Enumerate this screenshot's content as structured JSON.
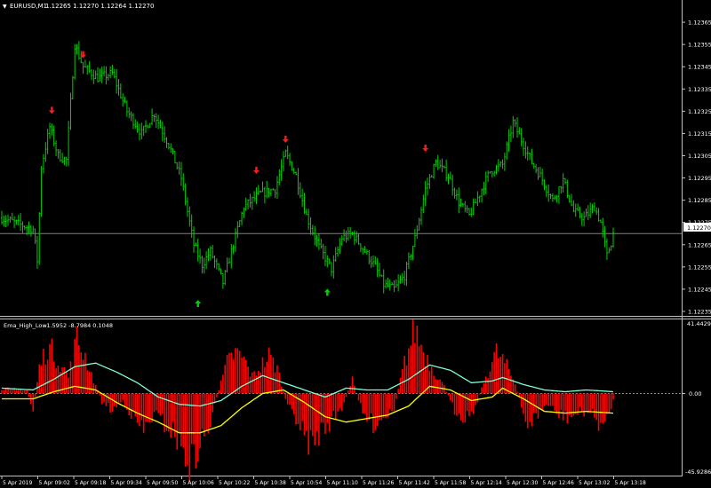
{
  "symbol_header": {
    "menu_glyph": "▼",
    "symbol": "EURUSD,M1",
    "quote": "1.12265 1.12270 1.12264 1.12270"
  },
  "price_axis": {
    "ticks": [
      "1.12365",
      "1.12355",
      "1.12345",
      "1.12335",
      "1.12325",
      "1.12315",
      "1.12305",
      "1.12295",
      "1.12285",
      "1.12275",
      "1.12265",
      "1.12255",
      "1.12245",
      "1.12235"
    ],
    "current_price_label": "1.12270"
  },
  "indicator_header": {
    "name": "Ema_High_Low",
    "values": "-1.5952 -8.7984 0.1048"
  },
  "indicator_axis": {
    "top": "41.4429",
    "zero": "0.00",
    "bottom": "-45.9286"
  },
  "time_axis": {
    "labels": [
      "5 Apr 2019",
      "5 Apr 09:02",
      "5 Apr 09:18",
      "5 Apr 09:34",
      "5 Apr 09:50",
      "5 Apr 10:06",
      "5 Apr 10:22",
      "5 Apr 10:38",
      "5 Apr 10:54",
      "5 Apr 11:10",
      "5 Apr 11:26",
      "5 Apr 11:42",
      "5 Apr 11:58",
      "5 Apr 12:14",
      "5 Apr 12:30",
      "5 Apr 12:46",
      "5 Apr 13:02",
      "5 Apr 13:18"
    ]
  },
  "colors": {
    "background": "#000000",
    "candle": "#00d000",
    "sell_arrow": "#ff1a1a",
    "buy_arrow": "#00d000",
    "histogram": "#ff0000",
    "ema_high": "#7fffd4",
    "ema_low": "#ffff00",
    "axis_text": "#ffffff",
    "grid_border": "#c0c0c0",
    "price_line": "#808080"
  },
  "chart_data": [
    {
      "type": "candlestick",
      "symbol": "EURUSD",
      "timeframe": "M1",
      "x_start": "5 Apr 2019 08:34",
      "x_end": "5 Apr 13:26",
      "ylim": [
        1.12233,
        1.12375
      ],
      "current_price": 1.1227,
      "close_path": [
        {
          "t": 0,
          "v": 1.12277
        },
        {
          "t": 15,
          "v": 1.12272
        },
        {
          "t": 17,
          "v": 1.12258
        },
        {
          "t": 19,
          "v": 1.123
        },
        {
          "t": 23,
          "v": 1.12318
        },
        {
          "t": 27,
          "v": 1.12305
        },
        {
          "t": 31,
          "v": 1.12303
        },
        {
          "t": 35,
          "v": 1.12355
        },
        {
          "t": 39,
          "v": 1.12345
        },
        {
          "t": 46,
          "v": 1.1234
        },
        {
          "t": 53,
          "v": 1.12342
        },
        {
          "t": 60,
          "v": 1.12325
        },
        {
          "t": 67,
          "v": 1.12315
        },
        {
          "t": 73,
          "v": 1.12324
        },
        {
          "t": 80,
          "v": 1.1231
        },
        {
          "t": 86,
          "v": 1.12295
        },
        {
          "t": 92,
          "v": 1.12265
        },
        {
          "t": 96,
          "v": 1.12256
        },
        {
          "t": 100,
          "v": 1.12262
        },
        {
          "t": 106,
          "v": 1.12248
        },
        {
          "t": 110,
          "v": 1.12262
        },
        {
          "t": 116,
          "v": 1.12282
        },
        {
          "t": 124,
          "v": 1.12288
        },
        {
          "t": 131,
          "v": 1.1229
        },
        {
          "t": 136,
          "v": 1.12306
        },
        {
          "t": 141,
          "v": 1.12296
        },
        {
          "t": 146,
          "v": 1.12278
        },
        {
          "t": 152,
          "v": 1.12264
        },
        {
          "t": 158,
          "v": 1.12254
        },
        {
          "t": 163,
          "v": 1.12268
        },
        {
          "t": 168,
          "v": 1.1227
        },
        {
          "t": 174,
          "v": 1.12262
        },
        {
          "t": 179,
          "v": 1.12255
        },
        {
          "t": 183,
          "v": 1.12247
        },
        {
          "t": 188,
          "v": 1.12245
        },
        {
          "t": 193,
          "v": 1.12251
        },
        {
          "t": 198,
          "v": 1.12268
        },
        {
          "t": 203,
          "v": 1.1229
        },
        {
          "t": 208,
          "v": 1.12302
        },
        {
          "t": 214,
          "v": 1.12296
        },
        {
          "t": 219,
          "v": 1.12284
        },
        {
          "t": 224,
          "v": 1.12278
        },
        {
          "t": 229,
          "v": 1.12288
        },
        {
          "t": 234,
          "v": 1.12298
        },
        {
          "t": 240,
          "v": 1.12301
        },
        {
          "t": 245,
          "v": 1.1232
        },
        {
          "t": 249,
          "v": 1.12312
        },
        {
          "t": 254,
          "v": 1.12302
        },
        {
          "t": 258,
          "v": 1.12296
        },
        {
          "t": 264,
          "v": 1.12285
        },
        {
          "t": 269,
          "v": 1.12294
        },
        {
          "t": 274,
          "v": 1.1228
        },
        {
          "t": 279,
          "v": 1.12277
        },
        {
          "t": 284,
          "v": 1.12282
        },
        {
          "t": 287,
          "v": 1.12275
        },
        {
          "t": 290,
          "v": 1.1226
        },
        {
          "t": 292,
          "v": 1.12266
        },
        {
          "t": 293,
          "v": 1.1227
        }
      ],
      "sell_signals": [
        {
          "t": 24,
          "v": 1.12325
        },
        {
          "t": 39,
          "v": 1.1235
        },
        {
          "t": 122,
          "v": 1.12298
        },
        {
          "t": 136,
          "v": 1.12312
        },
        {
          "t": 203,
          "v": 1.12308
        }
      ],
      "buy_signals": [
        {
          "t": 94,
          "v": 1.12239
        },
        {
          "t": 156,
          "v": 1.12244
        }
      ]
    },
    {
      "type": "histogram",
      "title": "Ema_High_Low",
      "last_values": [
        -1.5952,
        -8.7984,
        0.1048
      ],
      "ylim": [
        -45.9286,
        41.4429
      ],
      "histogram_path": [
        {
          "t": 0,
          "v": 3
        },
        {
          "t": 12,
          "v": 2
        },
        {
          "t": 15,
          "v": -10
        },
        {
          "t": 18,
          "v": 15
        },
        {
          "t": 22,
          "v": 28
        },
        {
          "t": 27,
          "v": 20
        },
        {
          "t": 32,
          "v": 10
        },
        {
          "t": 36,
          "v": 32
        },
        {
          "t": 40,
          "v": 22
        },
        {
          "t": 44,
          "v": 8
        },
        {
          "t": 48,
          "v": -5
        },
        {
          "t": 53,
          "v": -10
        },
        {
          "t": 58,
          "v": -4
        },
        {
          "t": 63,
          "v": -14
        },
        {
          "t": 68,
          "v": -22
        },
        {
          "t": 73,
          "v": -12
        },
        {
          "t": 78,
          "v": -18
        },
        {
          "t": 83,
          "v": -24
        },
        {
          "t": 87,
          "v": -35
        },
        {
          "t": 91,
          "v": -42
        },
        {
          "t": 95,
          "v": -30
        },
        {
          "t": 100,
          "v": -18
        },
        {
          "t": 104,
          "v": 2
        },
        {
          "t": 108,
          "v": 18
        },
        {
          "t": 112,
          "v": 24
        },
        {
          "t": 116,
          "v": 20
        },
        {
          "t": 120,
          "v": 10
        },
        {
          "t": 124,
          "v": 16
        },
        {
          "t": 128,
          "v": 22
        },
        {
          "t": 132,
          "v": 15
        },
        {
          "t": 137,
          "v": -8
        },
        {
          "t": 141,
          "v": -14
        },
        {
          "t": 145,
          "v": -26
        },
        {
          "t": 149,
          "v": -30
        },
        {
          "t": 153,
          "v": -22
        },
        {
          "t": 158,
          "v": -16
        },
        {
          "t": 163,
          "v": -8
        },
        {
          "t": 168,
          "v": 8
        },
        {
          "t": 173,
          "v": -12
        },
        {
          "t": 178,
          "v": -18
        },
        {
          "t": 183,
          "v": -14
        },
        {
          "t": 188,
          "v": -8
        },
        {
          "t": 193,
          "v": 18
        },
        {
          "t": 198,
          "v": 38
        },
        {
          "t": 202,
          "v": 25
        },
        {
          "t": 207,
          "v": 14
        },
        {
          "t": 212,
          "v": 4
        },
        {
          "t": 217,
          "v": -10
        },
        {
          "t": 222,
          "v": -14
        },
        {
          "t": 227,
          "v": -8
        },
        {
          "t": 232,
          "v": 10
        },
        {
          "t": 237,
          "v": 24
        },
        {
          "t": 241,
          "v": 18
        },
        {
          "t": 246,
          "v": 6
        },
        {
          "t": 251,
          "v": -18
        },
        {
          "t": 256,
          "v": -14
        },
        {
          "t": 261,
          "v": -6
        },
        {
          "t": 266,
          "v": -12
        },
        {
          "t": 271,
          "v": -14
        },
        {
          "t": 276,
          "v": -12
        },
        {
          "t": 281,
          "v": -10
        },
        {
          "t": 285,
          "v": -16
        },
        {
          "t": 289,
          "v": -20
        },
        {
          "t": 293,
          "v": -4
        }
      ],
      "ema_high_path": [
        {
          "t": 0,
          "v": 3
        },
        {
          "t": 15,
          "v": 2
        },
        {
          "t": 25,
          "v": 8
        },
        {
          "t": 35,
          "v": 15
        },
        {
          "t": 45,
          "v": 17
        },
        {
          "t": 55,
          "v": 12
        },
        {
          "t": 65,
          "v": 6
        },
        {
          "t": 75,
          "v": -2
        },
        {
          "t": 85,
          "v": -6
        },
        {
          "t": 95,
          "v": -7
        },
        {
          "t": 105,
          "v": -4
        },
        {
          "t": 115,
          "v": 4
        },
        {
          "t": 125,
          "v": 10
        },
        {
          "t": 135,
          "v": 6
        },
        {
          "t": 145,
          "v": 2
        },
        {
          "t": 155,
          "v": -2
        },
        {
          "t": 165,
          "v": 3
        },
        {
          "t": 175,
          "v": 2
        },
        {
          "t": 185,
          "v": 2
        },
        {
          "t": 195,
          "v": 8
        },
        {
          "t": 205,
          "v": 16
        },
        {
          "t": 215,
          "v": 13
        },
        {
          "t": 225,
          "v": 6
        },
        {
          "t": 235,
          "v": 7
        },
        {
          "t": 240,
          "v": 9
        },
        {
          "t": 250,
          "v": 5
        },
        {
          "t": 260,
          "v": 2
        },
        {
          "t": 270,
          "v": 1
        },
        {
          "t": 280,
          "v": 2
        },
        {
          "t": 293,
          "v": 1
        }
      ],
      "ema_low_path": [
        {
          "t": 0,
          "v": -3
        },
        {
          "t": 15,
          "v": -3
        },
        {
          "t": 25,
          "v": 1
        },
        {
          "t": 35,
          "v": 4
        },
        {
          "t": 45,
          "v": 2
        },
        {
          "t": 55,
          "v": -5
        },
        {
          "t": 65,
          "v": -11
        },
        {
          "t": 75,
          "v": -16
        },
        {
          "t": 85,
          "v": -22
        },
        {
          "t": 95,
          "v": -22
        },
        {
          "t": 105,
          "v": -18
        },
        {
          "t": 115,
          "v": -8
        },
        {
          "t": 125,
          "v": 0
        },
        {
          "t": 135,
          "v": 2
        },
        {
          "t": 145,
          "v": -5
        },
        {
          "t": 155,
          "v": -13
        },
        {
          "t": 165,
          "v": -16
        },
        {
          "t": 175,
          "v": -14
        },
        {
          "t": 185,
          "v": -12
        },
        {
          "t": 195,
          "v": -7
        },
        {
          "t": 205,
          "v": 4
        },
        {
          "t": 215,
          "v": 2
        },
        {
          "t": 225,
          "v": -4
        },
        {
          "t": 235,
          "v": -2
        },
        {
          "t": 240,
          "v": 3
        },
        {
          "t": 250,
          "v": -3
        },
        {
          "t": 260,
          "v": -10
        },
        {
          "t": 270,
          "v": -11
        },
        {
          "t": 280,
          "v": -10
        },
        {
          "t": 293,
          "v": -11
        }
      ]
    }
  ]
}
